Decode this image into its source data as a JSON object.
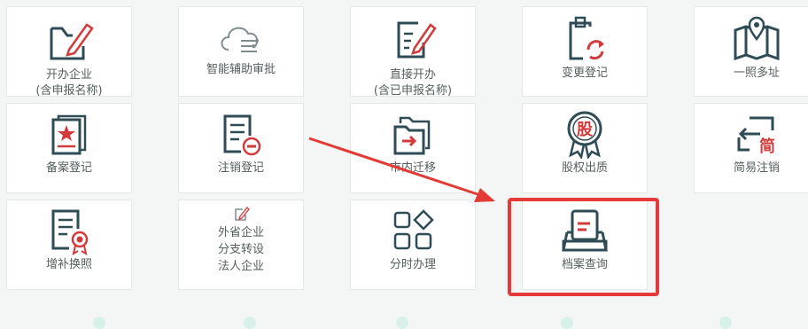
{
  "colors": {
    "icon_stroke": "#2f4c56",
    "icon_accent": "#d23b3b",
    "highlight": "#e63a3a",
    "arrow": "#e23b35",
    "label": "#555e5e"
  },
  "tiles": [
    {
      "name": "open-business",
      "icon": "folder-pen-icon",
      "lines": [
        "开办企业",
        "(含申报名称)"
      ]
    },
    {
      "name": "smart-approval",
      "icon": "cloud-circuit-icon",
      "lines": [
        "智能辅助审批"
      ]
    },
    {
      "name": "direct-open",
      "icon": "document-pen-icon",
      "lines": [
        "直接开办",
        "(含已申报名称)"
      ]
    },
    {
      "name": "change-registration",
      "icon": "clipboard-refresh-icon",
      "lines": [
        "变更登记"
      ]
    },
    {
      "name": "one-license-multi-address",
      "icon": "map-pin-icon",
      "lines": [
        "一照多址"
      ]
    },
    {
      "name": "filing-registration",
      "icon": "certificate-star-icon",
      "lines": [
        "备案登记"
      ]
    },
    {
      "name": "cancellation-registration",
      "icon": "document-minus-icon",
      "lines": [
        "注销登记"
      ]
    },
    {
      "name": "in-city-relocation",
      "icon": "folder-arrow-icon",
      "lines": [
        "市内迁移"
      ]
    },
    {
      "name": "equity-pledge",
      "icon": "equity-badge-icon",
      "icon_text": "股",
      "lines": [
        "股权出质"
      ]
    },
    {
      "name": "simple-cancellation",
      "icon": "return-arrow-icon",
      "icon_text": "简",
      "lines": [
        "简易注销"
      ]
    },
    {
      "name": "license-reissue",
      "icon": "document-ribbon-icon",
      "lines": [
        "增补换照"
      ]
    },
    {
      "name": "branch-conversion",
      "icon": "small-pen-icon",
      "lines": [
        "外省企业",
        "分支转设",
        "法人企业"
      ]
    },
    {
      "name": "timesharing-handling",
      "icon": "grid-shapes-icon",
      "lines": [
        "分时办理"
      ]
    },
    {
      "name": "archive-query",
      "icon": "inbox-document-icon",
      "lines": [
        "档案查询"
      ]
    }
  ]
}
